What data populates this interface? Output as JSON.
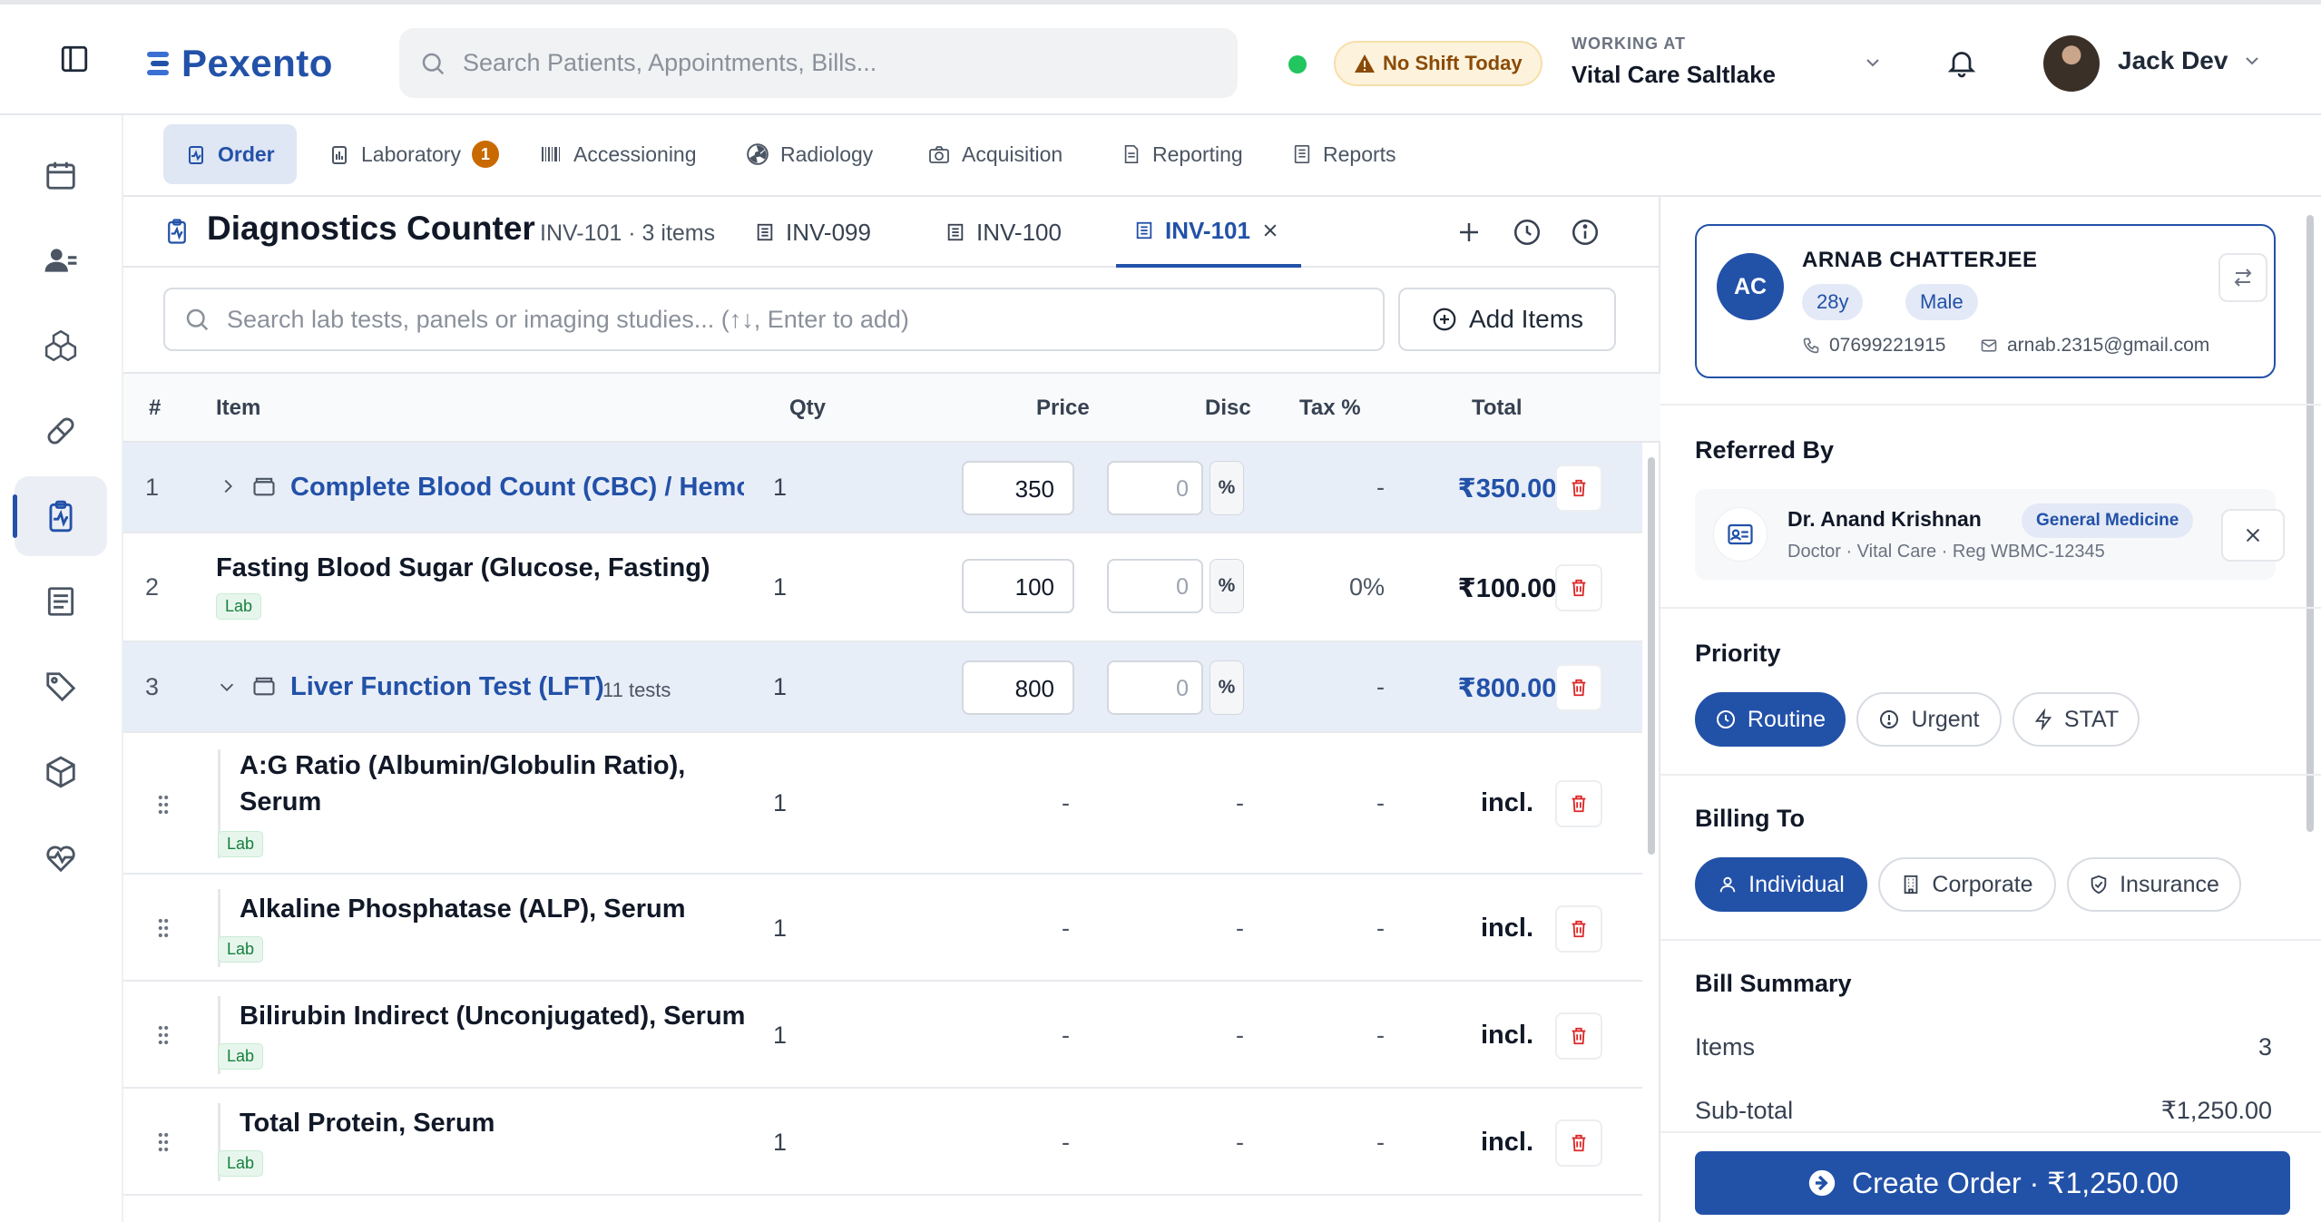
{
  "header": {
    "logo": "Pexento",
    "search_placeholder": "Search Patients, Appointments, Bills...",
    "shift_badge": "No Shift Today",
    "working_label": "WORKING AT",
    "working_value": "Vital Care Saltlake",
    "user_name": "Jack Dev"
  },
  "sidebar": {
    "items": [
      {
        "icon": "calendar-icon"
      },
      {
        "icon": "patients-icon"
      },
      {
        "icon": "cubes-icon"
      },
      {
        "icon": "pill-icon"
      },
      {
        "icon": "diagnostics-icon",
        "active": true
      },
      {
        "icon": "billing-icon"
      },
      {
        "icon": "tag-icon"
      },
      {
        "icon": "box-icon"
      },
      {
        "icon": "vitals-icon"
      }
    ]
  },
  "module_tabs": [
    {
      "label": "Order",
      "active": true
    },
    {
      "label": "Laboratory",
      "badge": "1"
    },
    {
      "label": "Accessioning"
    },
    {
      "label": "Radiology"
    },
    {
      "label": "Acquisition"
    },
    {
      "label": "Reporting"
    },
    {
      "label": "Reports"
    }
  ],
  "counter": {
    "title": "Diagnostics Counter",
    "subtitle": "INV-101 · 3 items",
    "invoices": [
      "INV-099",
      "INV-100",
      "INV-101"
    ],
    "active_invoice": "INV-101",
    "search_placeholder": "Search lab tests, panels or imaging studies... (↑↓, Enter to add)",
    "add_items_label": "Add Items"
  },
  "table": {
    "columns": {
      "num": "#",
      "item": "Item",
      "qty": "Qty",
      "price": "Price",
      "disc": "Disc",
      "tax": "Tax %",
      "total": "Total"
    },
    "rows": [
      {
        "num": "1",
        "name": "Complete Blood Count (CBC) / Hemogl",
        "qty": "1",
        "price": "350",
        "disc": "0",
        "pct": "%",
        "tax": "-",
        "total": "₹350.00"
      },
      {
        "num": "2",
        "name": "Fasting Blood Sugar (Glucose, Fasting)",
        "badge": "Lab",
        "qty": "1",
        "price": "100",
        "disc": "0",
        "pct": "%",
        "tax": "0%",
        "total": "₹100.00"
      },
      {
        "num": "3",
        "name": "Liver Function Test (LFT)",
        "tests": "11 tests",
        "qty": "1",
        "price": "800",
        "disc": "0",
        "pct": "%",
        "tax": "-",
        "total": "₹800.00"
      }
    ],
    "children": [
      {
        "name_line1": "A:G Ratio (Albumin/Globulin Ratio),",
        "name_line2": "Serum",
        "badge": "Lab",
        "qty": "1",
        "price": "-",
        "disc": "-",
        "tax": "-",
        "total": "incl."
      },
      {
        "name_line1": "Alkaline Phosphatase (ALP), Serum",
        "badge": "Lab",
        "qty": "1",
        "price": "-",
        "disc": "-",
        "tax": "-",
        "total": "incl."
      },
      {
        "name_line1": "Bilirubin Indirect (Unconjugated), Serum",
        "badge": "Lab",
        "qty": "1",
        "price": "-",
        "disc": "-",
        "tax": "-",
        "total": "incl."
      },
      {
        "name_line1": "Total Protein, Serum",
        "badge": "Lab",
        "qty": "1",
        "price": "-",
        "disc": "-",
        "tax": "-",
        "total": "incl."
      }
    ]
  },
  "patient": {
    "initials": "AC",
    "name": "ARNAB CHATTERJEE",
    "age": "28y",
    "gender": "Male",
    "phone": "07699221915",
    "email": "arnab.2315@gmail.com"
  },
  "referred": {
    "heading": "Referred By",
    "doctor": "Dr. Anand Krishnan",
    "specialty": "General Medicine",
    "meta": "Doctor · Vital Care · Reg WBMC-12345"
  },
  "priority": {
    "heading": "Priority",
    "options": [
      "Routine",
      "Urgent",
      "STAT"
    ],
    "selected": "Routine"
  },
  "billing": {
    "heading": "Billing To",
    "options": [
      "Individual",
      "Corporate",
      "Insurance"
    ],
    "selected": "Individual"
  },
  "summary": {
    "heading": "Bill Summary",
    "items_label": "Items",
    "items_value": "3",
    "subtotal_label": "Sub-total",
    "subtotal_value": "₹1,250.00"
  },
  "create_button": "Create Order · ₹1,250.00",
  "colors": {
    "accent": "#2251a8",
    "danger": "#dc2626",
    "success": "#22c55e"
  }
}
